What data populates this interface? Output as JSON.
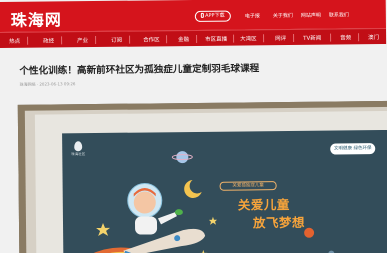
{
  "header": {
    "logo": "珠海网",
    "app_button": "APP下载",
    "top_links": [
      "电子报",
      "关于我们",
      "网站声明",
      "联系我们"
    ]
  },
  "nav": {
    "items": [
      "热点",
      "政经",
      "产业",
      "订阅",
      "合作区",
      "金融",
      "市区直播",
      "大湾区",
      "网评",
      "TV新闻",
      "音频",
      "澳门"
    ]
  },
  "article": {
    "title": "个性化训练！高新前环社区为孤独症儿童定制羽毛球课程",
    "meta": "珠海网络 · 2023-06-13 09:26"
  },
  "poster": {
    "logo_text": "珠海社区",
    "badge": "文明健康 绿色环保",
    "tagline": "关爱孤独症儿童",
    "headline_line1": "关爱儿童",
    "headline_line2": "放飞梦想"
  },
  "colors": {
    "brand_red": "#d5141c",
    "nav_red": "#c10e16",
    "poster_bg": "#334d5a",
    "poster_accent": "#f7a43b"
  }
}
